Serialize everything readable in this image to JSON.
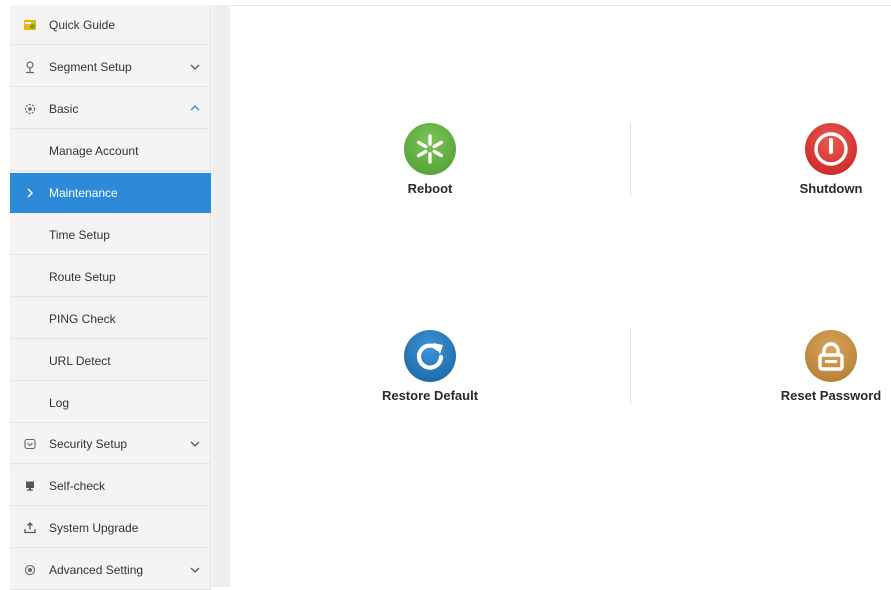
{
  "sidebar": {
    "items": [
      {
        "label": "Quick Guide",
        "icon": "quick-guide-icon"
      },
      {
        "label": "Segment Setup",
        "icon": "segment-icon",
        "chevron": "down"
      },
      {
        "label": "Basic",
        "icon": "basic-icon",
        "chevron": "up"
      },
      {
        "label": "Manage Account"
      },
      {
        "label": "Maintenance",
        "active": true
      },
      {
        "label": "Time Setup"
      },
      {
        "label": "Route Setup"
      },
      {
        "label": "PING Check"
      },
      {
        "label": "URL Detect"
      },
      {
        "label": "Log"
      },
      {
        "label": "Security Setup",
        "icon": "shield-icon",
        "chevron": "down"
      },
      {
        "label": "Self-check",
        "icon": "monitor-icon"
      },
      {
        "label": "System Upgrade",
        "icon": "upload-icon"
      },
      {
        "label": "Advanced Setting",
        "icon": "advanced-icon",
        "chevron": "down"
      }
    ]
  },
  "main": {
    "actions": [
      {
        "label": "Reboot",
        "icon": "reboot-icon",
        "color": "#5aa43d"
      },
      {
        "label": "Shutdown",
        "icon": "power-icon",
        "color": "#d8302c"
      },
      {
        "label": "Restore Default",
        "icon": "restore-icon",
        "color": "#1f72b8"
      },
      {
        "label": "Reset Password",
        "icon": "lock-icon",
        "color": "#c28a3f"
      }
    ]
  },
  "colors": {
    "accent": "#2d8ad8",
    "sidebar_bg": "#f4f4f4"
  }
}
